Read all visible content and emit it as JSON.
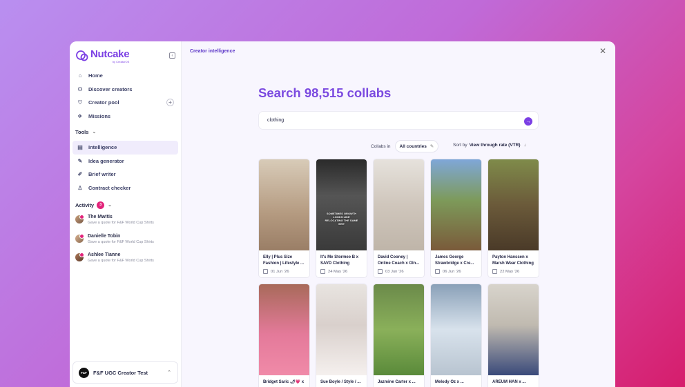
{
  "brand": {
    "name": "Nutcake",
    "sub": "by CreatorOS"
  },
  "sidebar": {
    "items": [
      {
        "label": "Home",
        "icon": "home-icon",
        "glyph": "⌂"
      },
      {
        "label": "Discover creators",
        "icon": "users-icon",
        "glyph": "⚇"
      },
      {
        "label": "Creator pool",
        "icon": "heart-icon",
        "glyph": "♡"
      },
      {
        "label": "Missions",
        "icon": "rocket-icon",
        "glyph": "✈"
      }
    ],
    "tools_title": "Tools",
    "tools": [
      {
        "label": "Intelligence",
        "icon": "intelligence-icon",
        "glyph": "▤",
        "active": true
      },
      {
        "label": "Idea generator",
        "icon": "wand-icon",
        "glyph": "✎"
      },
      {
        "label": "Brief writer",
        "icon": "pen-icon",
        "glyph": "✐"
      },
      {
        "label": "Contract checker",
        "icon": "stamp-icon",
        "glyph": "♙"
      }
    ],
    "activity_title": "Activity",
    "activity_count": "3",
    "activity": [
      {
        "name": "The Mwitis",
        "desc": "Gave a quote for F&F World Cup Shirts"
      },
      {
        "name": "Danielle Tobin",
        "desc": "Gave a quote for F&F World Cup Shirts"
      },
      {
        "name": "Ashlee Tianne",
        "desc": "Gave a quote for F&F World Cup Shirts"
      }
    ],
    "workspace": {
      "logo": "F&F",
      "name": "F&F UGC Creator Test"
    }
  },
  "main": {
    "page_label": "Creator intelligence",
    "headline": "Search 98,515 collabs",
    "search_value": "clothing",
    "collabs_in_label": "Collabs in",
    "country": "All countries",
    "sort_label": "Sort by",
    "sort_value": "View through rate (VTR)",
    "cards": [
      {
        "title": "Elly | Plus Size Fashion | Lifestyle ...",
        "date": "01 Jun '26",
        "bg": "linear-gradient(180deg,#d8cbb8,#b49a80 60%,#9a7e66)",
        "overlay": ""
      },
      {
        "title": "It's Me Stormee B x SAVD Clothing",
        "date": "24 May '26",
        "bg": "linear-gradient(180deg,#2a2a2a,#555 40%,#3a3a3a)",
        "overlay": "SOMETIMES GROWTH LOOKS LIKE RELOCATING THE SAME SHIT"
      },
      {
        "title": "David Cooney | Online Coach x Oln...",
        "date": "03 Jun '26",
        "bg": "linear-gradient(180deg,#e6e2dc,#cfc6bc 50%,#bfb5a9)",
        "overlay": ""
      },
      {
        "title": "James George Strawbridge x Cre...",
        "date": "06 Jun '26",
        "bg": "linear-gradient(180deg,#7fa7d8,#7d9a5a 45%,#7a5a3a)",
        "overlay": ""
      },
      {
        "title": "Payton Hanssen x Marsh Wear Clothing",
        "date": "22 May '26",
        "bg": "linear-gradient(180deg,#7f8b4a,#6b5a3a 50%,#4a3a28)",
        "overlay": ""
      },
      {
        "title": "Bridget Saric 🌶💗 x ...",
        "date": "",
        "bg": "linear-gradient(180deg,#a86a5a,#e47a9a 55%,#f08aa8)",
        "overlay": ""
      },
      {
        "title": "Sue Boyle / Style / ...",
        "date": "",
        "bg": "linear-gradient(180deg,#e8e4e0,#d9d0cc 45%,#f5f0ee)",
        "overlay": ""
      },
      {
        "title": "Jazmine Carter x ...",
        "date": "",
        "bg": "linear-gradient(180deg,#6b8a4a,#8ab05a 50%,#5a8a3a)",
        "overlay": ""
      },
      {
        "title": "Melody Oz x ...",
        "date": "",
        "bg": "linear-gradient(180deg,#8aa0b8,#d8e2ec 50%,#b8c4d0)",
        "overlay": ""
      },
      {
        "title": "AREUM HAN x ...",
        "date": "",
        "bg": "linear-gradient(180deg,#d8d4cc,#c0bab0 45%,#3a4a7a)",
        "overlay": ""
      }
    ]
  }
}
